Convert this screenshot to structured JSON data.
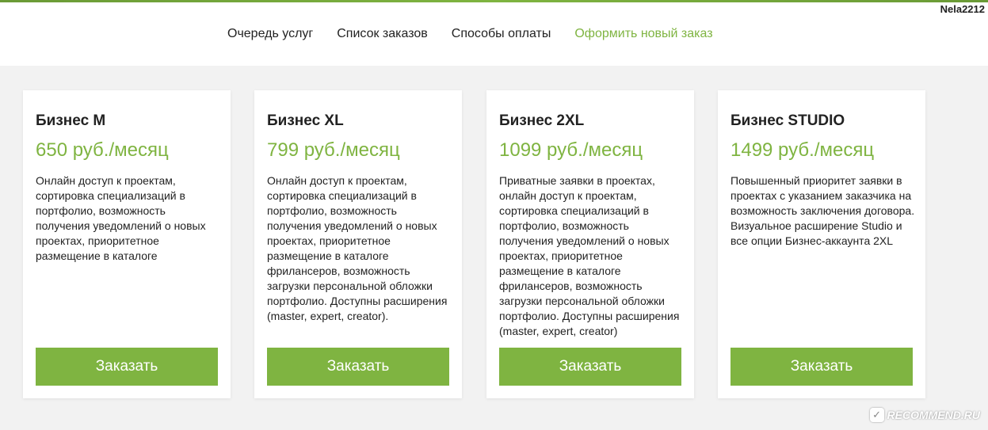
{
  "header": {
    "username": "Nela2212",
    "nav": [
      {
        "label": "Очередь услуг",
        "active": false
      },
      {
        "label": "Список заказов",
        "active": false
      },
      {
        "label": "Способы оплаты",
        "active": false
      },
      {
        "label": "Оформить новый заказ",
        "active": true
      }
    ]
  },
  "plans": [
    {
      "title": "Бизнес M",
      "price": "650 руб./месяц",
      "description": "Онлайн доступ к проектам, сортировка специализаций в портфолио, возможность получения уведомлений о новых проектах, приоритетное размещение в каталоге",
      "button_label": "Заказать"
    },
    {
      "title": "Бизнес XL",
      "price": "799 руб./месяц",
      "description": "Онлайн доступ к проектам, сортировка специализаций в портфолио, возможность получения уведомлений о новых проектах, приоритетное размещение в каталоге фрилансеров, возможность загрузки персональной обложки портфолио. Доступны расширения (master, expert, creator).",
      "button_label": "Заказать"
    },
    {
      "title": "Бизнес 2XL",
      "price": "1099 руб./месяц",
      "description": "Приватные заявки в проектах, онлайн доступ к проектам, сортировка специализаций в портфолио, возможность получения уведомлений о новых проектах, приоритетное размещение в каталоге фрилансеров, возможность загрузки персональной обложки портфолио. Доступны расширения (master, expert, creator)",
      "button_label": "Заказать"
    },
    {
      "title": "Бизнес STUDIO",
      "price": "1499 руб./месяц",
      "description": "Повышенный приоритет заявки в проектах с указанием заказчика на возможность заключения договора. Визуальное расширение Studio и все опции Бизнес-аккаунта 2XL",
      "button_label": "Заказать"
    }
  ],
  "watermark": {
    "text": "RECOMMEND.RU",
    "icon": "recommend-logo-icon"
  },
  "colors": {
    "accent": "#7fb441",
    "background": "#f2f2f2"
  }
}
